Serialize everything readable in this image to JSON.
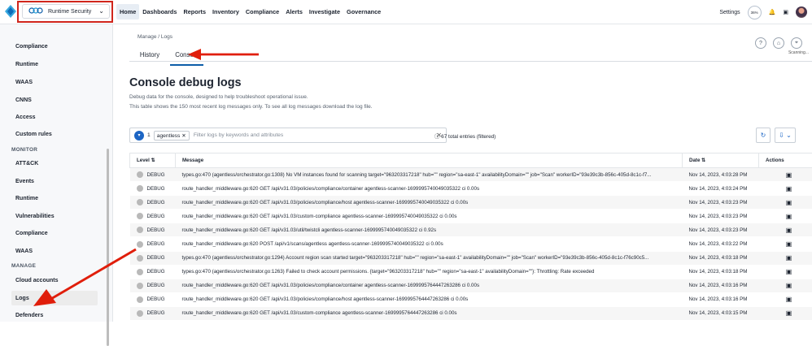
{
  "app": {
    "product": "Runtime Security"
  },
  "nav": [
    "Home",
    "Dashboards",
    "Reports",
    "Inventory",
    "Compliance",
    "Alerts",
    "Investigate",
    "Governance"
  ],
  "top_right": {
    "settings": "Settings",
    "badge": "36%"
  },
  "sidebar": {
    "items": [
      "Compliance",
      "Runtime",
      "WAAS",
      "CNNS",
      "Access",
      "Custom rules"
    ],
    "monitor_heading": "MONITOR",
    "monitor_items": [
      "ATT&CK",
      "Events",
      "Runtime",
      "Vulnerabilities",
      "Compliance",
      "WAAS"
    ],
    "manage_heading": "MANAGE",
    "manage_items": [
      "Cloud accounts",
      "Logs",
      "Defenders"
    ]
  },
  "breadcrumb": "Manage / Logs",
  "tabs": [
    "History",
    "Console"
  ],
  "title": "Console debug logs",
  "description": [
    "Debug data for the console, designed to help troubleshoot operational issue.",
    "This table shows the 150 most recent log messages only. To see all log messages download the log file."
  ],
  "scanning": "Scanning...",
  "filters": {
    "count": "1",
    "chip": "agentless",
    "placeholder": "Filter logs by keywords and attributes",
    "entries": "67 total entries (filtered)"
  },
  "table": {
    "headers": [
      "Level",
      "Message",
      "Date",
      "Actions"
    ],
    "rows": [
      {
        "level": "DEBUG",
        "message": "types.go:470 (agentless/orchestrator.go:1308) No VM instances found for scanning target=\"963203317218\" hub=\"\" region=\"sa-east-1\" availabilityDomain=\"\" job=\"Scan\" workerID=\"93e39c3b-856c-405d-8c1c-f7...",
        "date": "Nov 14, 2023, 4:03:28 PM"
      },
      {
        "level": "DEBUG",
        "message": "route_handler_middleware.go:620 GET /api/v31.03/policies/compliance/container agentless-scanner-1699995740049035322 ci 0.00s",
        "date": "Nov 14, 2023, 4:03:24 PM"
      },
      {
        "level": "DEBUG",
        "message": "route_handler_middleware.go:620 GET /api/v31.03/policies/compliance/host agentless-scanner-1699995740049035322 ci 0.00s",
        "date": "Nov 14, 2023, 4:03:23 PM"
      },
      {
        "level": "DEBUG",
        "message": "route_handler_middleware.go:620 GET /api/v31.03/custom-compliance agentless-scanner-1699995740049035322 ci 0.00s",
        "date": "Nov 14, 2023, 4:03:23 PM"
      },
      {
        "level": "DEBUG",
        "message": "route_handler_middleware.go:620 GET /api/v31.03/util/twistcli agentless-scanner-1699995740049035322 ci 0.92s",
        "date": "Nov 14, 2023, 4:03:23 PM"
      },
      {
        "level": "DEBUG",
        "message": "route_handler_middleware.go:620 POST /api/v1/scans/agentless agentless-scanner-1699995740049035322 ci 0.00s",
        "date": "Nov 14, 2023, 4:03:22 PM"
      },
      {
        "level": "DEBUG",
        "message": "types.go:470 (agentless/orchestrator.go:1294) Account region scan started target=\"963203317218\" hub=\"\" region=\"sa-east-1\" availabilityDomain=\"\" job=\"Scan\" workerID=\"93e39c3b-856c-405d-8c1c-f76c90c5...",
        "date": "Nov 14, 2023, 4:03:18 PM"
      },
      {
        "level": "DEBUG",
        "message": "types.go:470 (agentless/orchestrator.go:1263) Failed to check account permissions. {target=\"963203317218\" hub=\"\" region=\"sa-east-1\" availabilityDomain=\"\"}: Throttling: Rate exceeded",
        "date": "Nov 14, 2023, 4:03:18 PM"
      },
      {
        "level": "DEBUG",
        "message": "route_handler_middleware.go:620 GET /api/v31.03/policies/compliance/container agentless-scanner-1699995764447263286 ci 0.00s",
        "date": "Nov 14, 2023, 4:03:16 PM"
      },
      {
        "level": "DEBUG",
        "message": "route_handler_middleware.go:620 GET /api/v31.03/policies/compliance/host agentless-scanner-1699995764447263286 ci 0.00s",
        "date": "Nov 14, 2023, 4:03:16 PM"
      },
      {
        "level": "DEBUG",
        "message": "route_handler_middleware.go:620 GET /api/v31.03/custom-compliance agentless-scanner-1699995764447263286 ci 0.00s",
        "date": "Nov 14, 2023, 4:03:15 PM"
      }
    ]
  }
}
